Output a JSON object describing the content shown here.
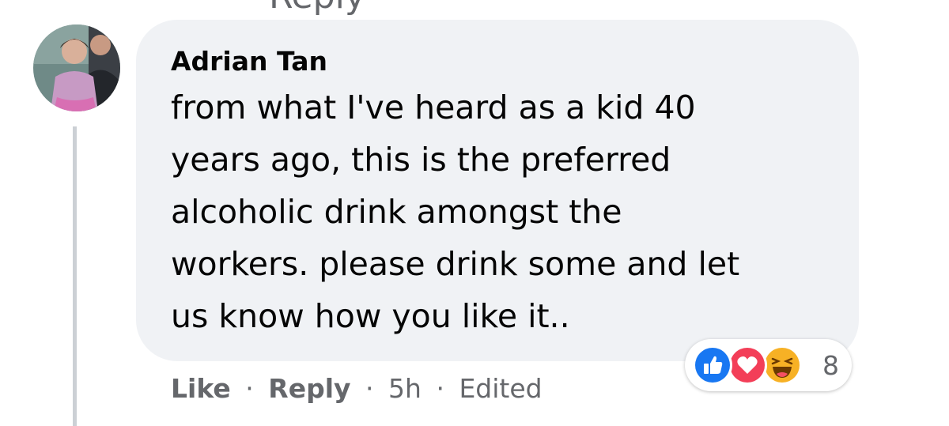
{
  "comment": {
    "author": "Adrian Tan",
    "lines": [
      "from what I've heard as a kid 40",
      "years ago, this is the preferred",
      "alcoholic drink amongst the",
      "workers. please drink some and let",
      "us know how you like it.."
    ],
    "reactions": {
      "icons": [
        "like-icon",
        "love-icon",
        "haha-icon"
      ],
      "count": "8",
      "colors": {
        "like": "#1877f2",
        "love": "#f33e58",
        "haha": "#f7b125"
      }
    },
    "actions": {
      "like": "Like",
      "separator": "·",
      "reply": "Reply",
      "time": "5h",
      "edited": "Edited"
    }
  },
  "previous": {
    "reply_label_partial": "Reply"
  }
}
